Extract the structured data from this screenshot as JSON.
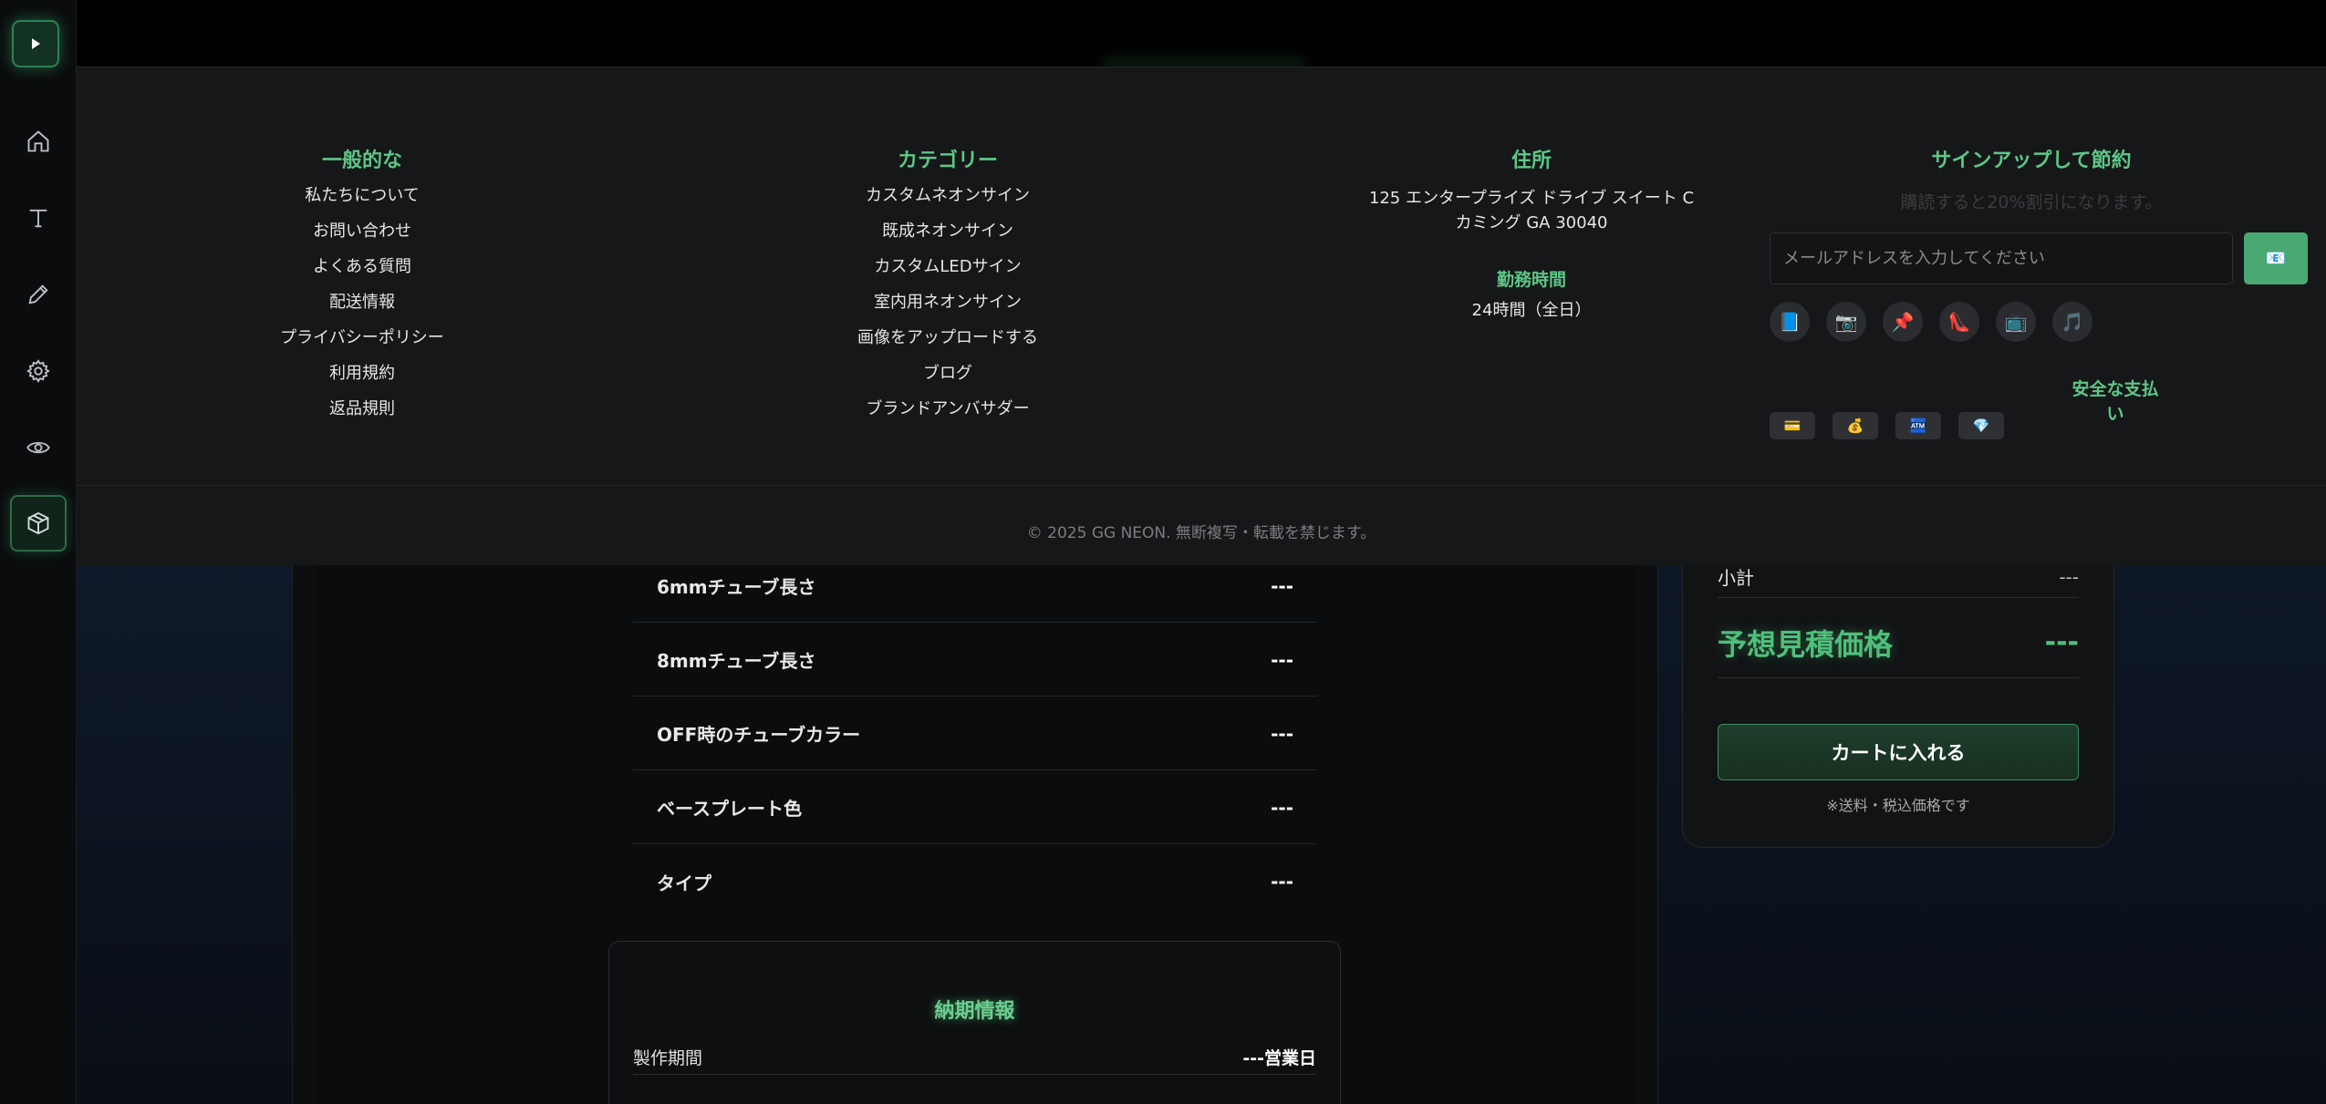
{
  "sidebar": {
    "items": [
      {
        "icon": "home-icon"
      },
      {
        "icon": "text-icon"
      },
      {
        "icon": "pen-icon"
      },
      {
        "icon": "gear-icon"
      },
      {
        "icon": "eye-icon"
      },
      {
        "icon": "cube-icon",
        "active": true
      }
    ]
  },
  "footer": {
    "general": {
      "title": "一般的な",
      "links": [
        "私たちについて",
        "お問い合わせ",
        "よくある質問",
        "配送情報",
        "プライバシーポリシー",
        "利用規約",
        "返品規則"
      ]
    },
    "categories": {
      "title": "カテゴリー",
      "links": [
        "カスタムネオンサイン",
        "既成ネオンサイン",
        "カスタムLEDサイン",
        "室内用ネオンサイン",
        "画像をアップロードする",
        "ブログ",
        "ブランドアンバサダー"
      ]
    },
    "address": {
      "title": "住所",
      "line1": "125 エンタープライズ ドライブ スイート C",
      "line2": "カミング GA 30040",
      "hours_title": "勤務時間",
      "hours_value": "24時間（全日）"
    },
    "signup": {
      "title": "サインアップして節約",
      "subtitle": "購読すると20%割引になります。",
      "email_placeholder": "メールアドレスを入力してください",
      "submit_icon": "📧",
      "social_icons": [
        "📘",
        "📷",
        "📌",
        "👠",
        "📺",
        "🎵"
      ],
      "payment_title": "安全な支払い",
      "payment_icons": [
        "💳",
        "💰",
        "🏧",
        "💎"
      ]
    },
    "copyright": "© 2025 GG NEON. 無断複写・転載を禁じます。"
  },
  "specs": [
    {
      "label": "6mmチューブ長さ",
      "value": "---"
    },
    {
      "label": "8mmチューブ長さ",
      "value": "---"
    },
    {
      "label": "OFF時のチューブカラー",
      "value": "---"
    },
    {
      "label": "ベースプレート色",
      "value": "---"
    },
    {
      "label": "タイプ",
      "value": "---"
    }
  ],
  "delivery": {
    "title": "納期情報",
    "label": "製作期間",
    "value": "---営業日"
  },
  "price": {
    "subtotal_label": "小計",
    "subtotal_value": "---",
    "estimate_label": "予想見積価格",
    "estimate_value": "---",
    "cart_button": "カートに入れる",
    "note": "※送料・税込価格です"
  },
  "colors": {
    "accent": "#5cc787",
    "background": "#0a0b0d",
    "footer": "#161718"
  }
}
